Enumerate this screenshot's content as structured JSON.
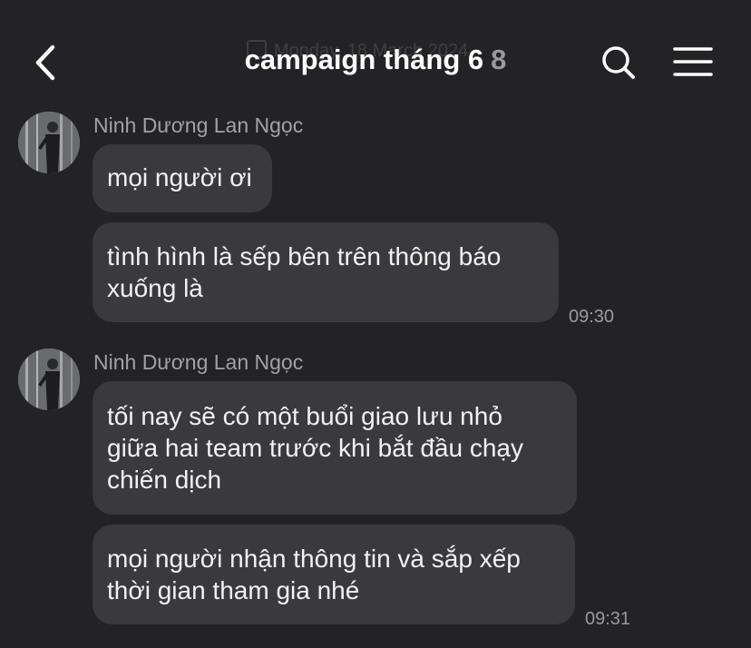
{
  "header": {
    "title": "campaign tháng 6",
    "member_count": "8",
    "ghost_date": "Monday, 18 March 2024",
    "back_icon": "chevron-left-icon",
    "search_icon": "search-icon",
    "menu_icon": "hamburger-menu-icon"
  },
  "groups": [
    {
      "sender": "Ninh Dương Lan Ngọc",
      "messages": [
        {
          "lines": [
            "mọi người ơi"
          ]
        },
        {
          "lines": [
            "tình hình là sếp bên trên thông báo",
            "xuống là"
          ],
          "time": "09:30"
        }
      ]
    },
    {
      "sender": "Ninh Dương Lan Ngọc",
      "messages": [
        {
          "lines": [
            "tối nay sẽ có một buổi giao lưu nhỏ",
            "giữa hai team trước khi bắt đầu chạy",
            "chiến dịch"
          ]
        },
        {
          "lines": [
            "mọi người nhận thông tin và sắp xếp",
            "thời gian tham gia nhé"
          ],
          "time": "09:31"
        }
      ]
    }
  ],
  "colors": {
    "background": "#232325",
    "bubble": "#3a3a3d",
    "text": "#f2f2f2",
    "secondary_text": "#9a9a9e"
  }
}
